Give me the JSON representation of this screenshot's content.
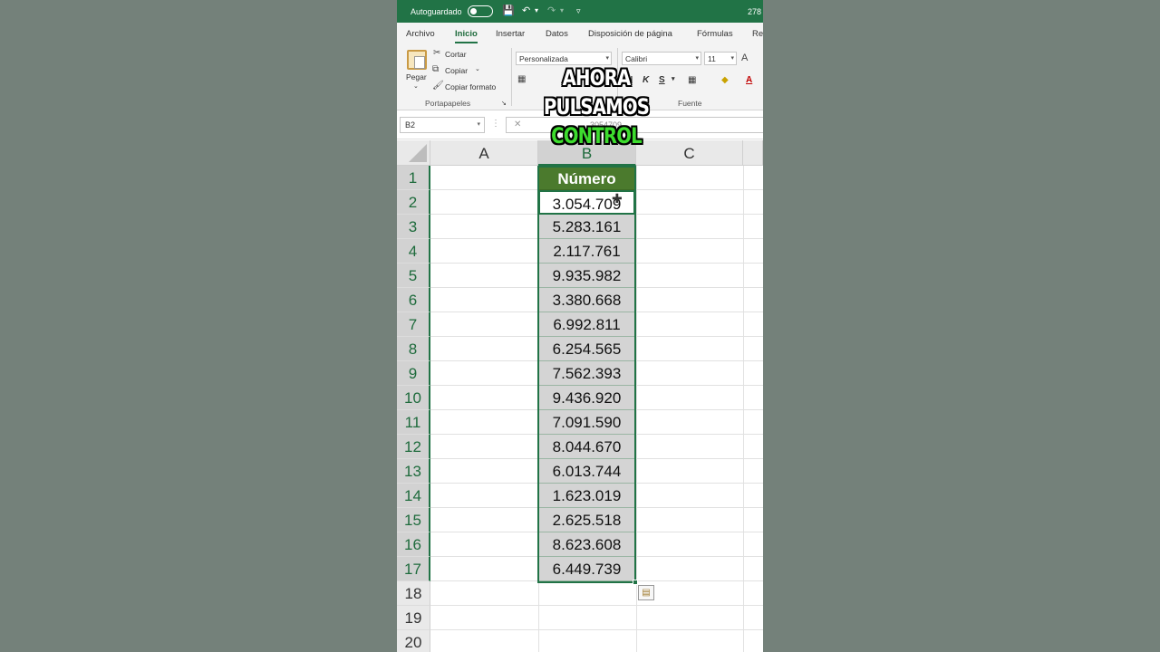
{
  "titlebar": {
    "autosave_label": "Autoguardado",
    "count": "278",
    "icons": [
      "toggle-off",
      "save-icon",
      "undo-icon",
      "redo-icon",
      "customize-icon"
    ]
  },
  "ribbon_tabs": [
    "Archivo",
    "Inicio",
    "Insertar",
    "Datos",
    "Disposición de página",
    "Fórmulas",
    "Re"
  ],
  "active_tab": "Inicio",
  "clipboard": {
    "paste": "Pegar",
    "cut": "Cortar",
    "copy": "Copiar",
    "format_painter": "Copiar formato",
    "group_label": "Portapapeles"
  },
  "number_format": {
    "value": "Personalizada"
  },
  "font": {
    "name": "Calibri",
    "size": "11",
    "bold": "N",
    "italic": "K",
    "underline": "S",
    "group_label": "Fuente",
    "grow": "A"
  },
  "formula_bar": {
    "name_box": "B2",
    "value": "3054709"
  },
  "columns": [
    "A",
    "B",
    "C"
  ],
  "rows": [
    "1",
    "2",
    "3",
    "4",
    "5",
    "6",
    "7",
    "8",
    "9",
    "10",
    "11",
    "12",
    "13",
    "14",
    "15",
    "16",
    "17",
    "18",
    "19",
    "20"
  ],
  "table": {
    "header": "Número",
    "values": [
      "3.054.709",
      "5.283.161",
      "2.117.761",
      "9.935.982",
      "3.380.668",
      "6.992.811",
      "6.254.565",
      "7.562.393",
      "9.436.920",
      "7.091.590",
      "8.044.670",
      "6.013.744",
      "1.623.019",
      "2.625.518",
      "8.623.608",
      "6.449.739"
    ]
  },
  "caption": {
    "line1": "AHORA",
    "line2": "PULSAMOS",
    "line3": "CONTROL"
  },
  "colors": {
    "excel_green": "#217346",
    "header_fill": "#4b7a2d",
    "caption_highlight": "#3ddc2e",
    "background": "#75827a"
  }
}
